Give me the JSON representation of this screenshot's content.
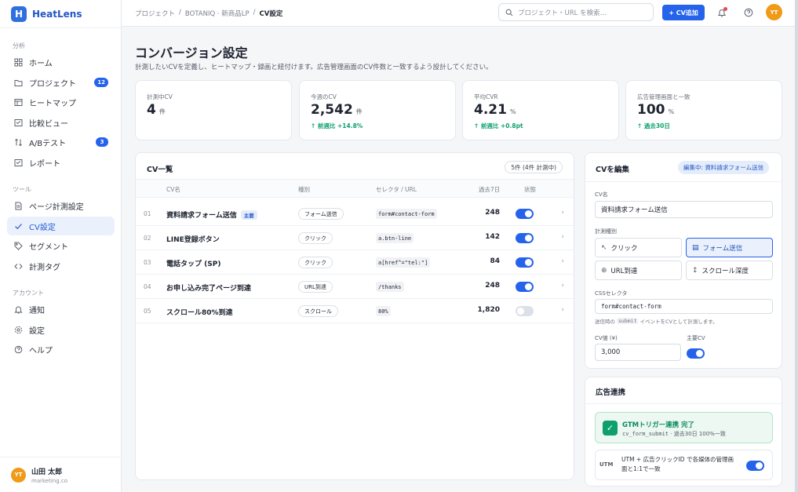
{
  "app": {
    "name": "HeatLens",
    "logo_letter": "H"
  },
  "sidebar": {
    "sections": {
      "analysis": "分析",
      "tools": "ツール",
      "account": "アカウント"
    },
    "items": [
      {
        "label": "ホーム",
        "icon": "grid-icon"
      },
      {
        "label": "プロジェクト",
        "icon": "folder-icon",
        "badge": "12"
      },
      {
        "label": "ヒートマップ",
        "icon": "heatmap-icon"
      },
      {
        "label": "比較ビュー",
        "icon": "compare-icon"
      },
      {
        "label": "A/Bテスト",
        "icon": "ab-test-icon",
        "badge": "3"
      },
      {
        "label": "レポート",
        "icon": "report-icon"
      },
      {
        "label": "ページ計測設定",
        "icon": "page-icon"
      },
      {
        "label": "CV設定",
        "icon": "check-icon",
        "active": true
      },
      {
        "label": "セグメント",
        "icon": "tag-icon"
      },
      {
        "label": "計測タグ",
        "icon": "code-icon"
      },
      {
        "label": "通知",
        "icon": "bell-icon"
      },
      {
        "label": "設定",
        "icon": "gear-icon"
      },
      {
        "label": "ヘルプ",
        "icon": "help-icon"
      }
    ],
    "user": {
      "initials": "YT",
      "name": "山田 太郎",
      "email": "marketing.co"
    }
  },
  "topbar": {
    "breadcrumb": [
      "プロジェクト",
      "BOTANIQ · 新商品LP",
      "CV設定"
    ],
    "search_placeholder": "プロジェクト・URL を検索…",
    "add_button": "+ CV追加",
    "avatar_initials": "YT"
  },
  "page": {
    "title": "コンバージョン設定",
    "description": "計測したいCVを定義し、ヒートマップ・録画と紐付けます。広告管理画面のCV件数と一致するよう設計してください。"
  },
  "stats": [
    {
      "label": "計測中CV",
      "value": "4",
      "unit": "件",
      "change": ""
    },
    {
      "label": "今週のCV",
      "value": "2,542",
      "unit": "件",
      "change": "↑ 前週比 +14.8%"
    },
    {
      "label": "平均CVR",
      "value": "4.21",
      "unit": "%",
      "change": "↑ 前週比 +0.8pt"
    },
    {
      "label": "広告管理画面と一致",
      "value": "100",
      "unit": "%",
      "change": "↑ 過去30日"
    }
  ],
  "cv_list": {
    "title": "CV一覧",
    "count_label": "5件 (4件 計測中)",
    "headers": [
      "CV名",
      "種別",
      "セレクタ / URL",
      "過去7日",
      "状態"
    ],
    "main_tag": "主要",
    "rows": [
      {
        "num": "01",
        "name": "資料請求フォーム送信",
        "main": true,
        "type": "フォーム送信",
        "selector": "form#contact-form",
        "count": "248",
        "on": true
      },
      {
        "num": "02",
        "name": "LINE登録ボタン",
        "main": false,
        "type": "クリック",
        "selector": "a.btn-line",
        "count": "142",
        "on": true
      },
      {
        "num": "03",
        "name": "電話タップ (SP)",
        "main": false,
        "type": "クリック",
        "selector": "a[href^=\"tel:\"]",
        "count": "84",
        "on": true
      },
      {
        "num": "04",
        "name": "お申し込み完了ページ到達",
        "main": false,
        "type": "URL到達",
        "selector": "/thanks",
        "count": "248",
        "on": true
      },
      {
        "num": "05",
        "name": "スクロール80%到達",
        "main": false,
        "type": "スクロール",
        "selector": "80%",
        "count": "1,820",
        "on": false
      }
    ]
  },
  "edit": {
    "title": "CVを編集",
    "badge": "編集中: 資料請求フォーム送信",
    "name_label": "CV名",
    "name_value": "資料請求フォーム送信",
    "method_label": "計測種別",
    "methods": [
      {
        "label": "クリック",
        "icon": "cursor-icon",
        "selected": false
      },
      {
        "label": "フォーム送信",
        "icon": "form-icon",
        "selected": true
      },
      {
        "label": "URL到達",
        "icon": "globe-icon",
        "selected": false
      },
      {
        "label": "スクロール深度",
        "icon": "scroll-icon",
        "selected": false
      }
    ],
    "selector_label": "CSSセレクタ",
    "selector_value": "form#contact-form",
    "help_before": "送信時の",
    "help_code": "submit",
    "help_after": "イベントをCVとして計測します。",
    "value_label": "CV値 (¥)",
    "value_value": "3,000",
    "main_cv_label": "主要CV",
    "main_cv_on": true
  },
  "ads": {
    "title": "広告連携",
    "gtm_title": "GTMトリガー連携 完了",
    "gtm_code": "cv_form_submit",
    "gtm_detail": " · 過去30日 100%一致",
    "utm_label": "UTM",
    "utm_text": "UTM + 広告クリックID で各媒体の管理画面と1:1で一致",
    "utm_on": true
  },
  "colors": {
    "accent": "#2563eb",
    "success": "#0d9f6e",
    "avatar": "#f09a1a",
    "brand": "#2f6fe0"
  }
}
